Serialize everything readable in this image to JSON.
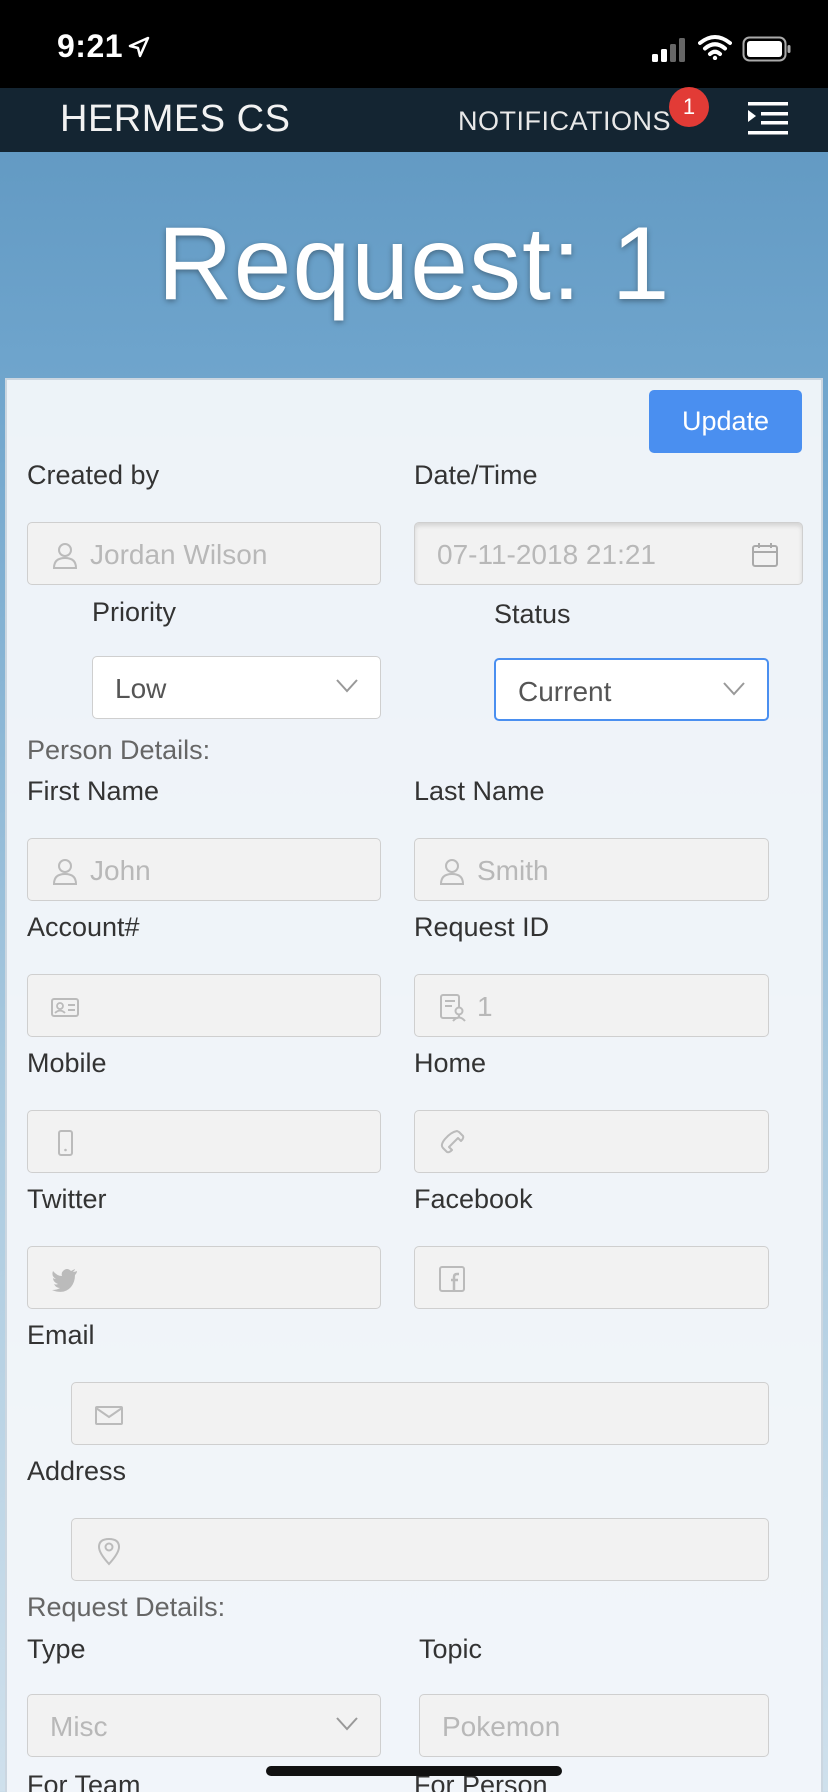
{
  "status_bar": {
    "time": "9:21"
  },
  "nav": {
    "brand": "HERMES CS",
    "notifications_label": "NOTIFICATIONS",
    "notifications_count": "1"
  },
  "page": {
    "title": "Request: 1"
  },
  "form": {
    "update_button": "Update",
    "created_by": {
      "label": "Created by",
      "value": "Jordan Wilson"
    },
    "date_time": {
      "label": "Date/Time",
      "value": "07-11-2018 21:21"
    },
    "priority": {
      "label": "Priority",
      "value": "Low"
    },
    "status": {
      "label": "Status",
      "value": "Current"
    },
    "person_section": "Person Details:",
    "first_name": {
      "label": "First Name",
      "value": "John"
    },
    "last_name": {
      "label": "Last Name",
      "value": "Smith"
    },
    "account": {
      "label": "Account#",
      "value": ""
    },
    "request_id": {
      "label": "Request ID",
      "value": "1"
    },
    "mobile": {
      "label": "Mobile",
      "value": ""
    },
    "home": {
      "label": "Home",
      "value": ""
    },
    "twitter": {
      "label": "Twitter",
      "value": ""
    },
    "facebook": {
      "label": "Facebook",
      "value": ""
    },
    "email": {
      "label": "Email",
      "value": ""
    },
    "address": {
      "label": "Address",
      "value": ""
    },
    "request_section": "Request Details:",
    "type": {
      "label": "Type",
      "value": "Misc"
    },
    "topic": {
      "label": "Topic",
      "value": "Pokemon"
    },
    "for_team": {
      "label": "For Team"
    },
    "for_person": {
      "label": "For Person"
    }
  },
  "colors": {
    "accent": "#4a8ff0",
    "navbar": "#142532",
    "badge": "#e23b36"
  }
}
